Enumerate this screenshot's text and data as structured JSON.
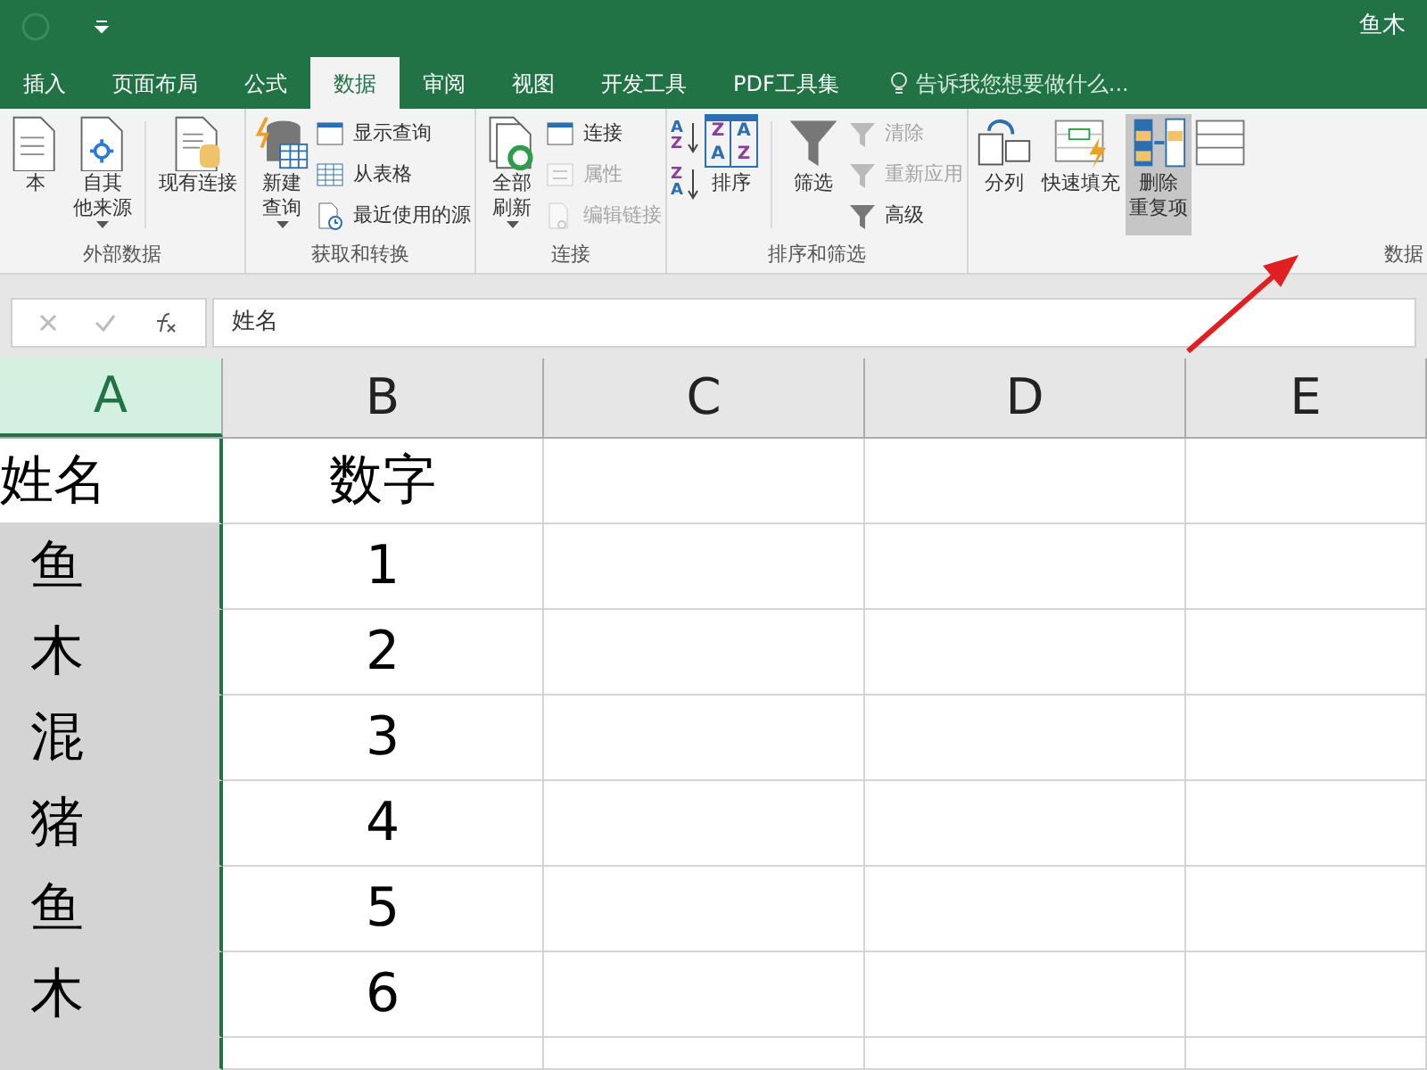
{
  "window": {
    "title": "鱼木"
  },
  "tabs": [
    {
      "label": "插入",
      "selected": false
    },
    {
      "label": "页面布局",
      "selected": false
    },
    {
      "label": "公式",
      "selected": false
    },
    {
      "label": "数据",
      "selected": true
    },
    {
      "label": "审阅",
      "selected": false
    },
    {
      "label": "视图",
      "selected": false
    },
    {
      "label": "开发工具",
      "selected": false
    },
    {
      "label": "PDF工具集",
      "selected": false
    }
  ],
  "tell_me": {
    "placeholder": "告诉我您想要做什么..."
  },
  "ribbon_groups": [
    {
      "label": "外部数据",
      "items": [
        {
          "kind": "large",
          "label": "本"
        },
        {
          "kind": "large",
          "label": "自其他来源",
          "dropdown": true
        },
        {
          "kind": "sep"
        },
        {
          "kind": "large",
          "label": "现有连接"
        }
      ]
    },
    {
      "label": "获取和转换",
      "items": [
        {
          "kind": "large",
          "label": "新建查询",
          "dropdown": true
        },
        {
          "kind": "stack",
          "rows": [
            {
              "label": "显示查询",
              "disabled": false
            },
            {
              "label": "从表格",
              "disabled": false
            },
            {
              "label": "最近使用的源",
              "disabled": false
            }
          ]
        }
      ]
    },
    {
      "label": "连接",
      "items": [
        {
          "kind": "large",
          "label": "全部刷新",
          "dropdown": true
        },
        {
          "kind": "stack",
          "rows": [
            {
              "label": "连接",
              "disabled": false
            },
            {
              "label": "属性",
              "disabled": true
            },
            {
              "label": "编辑链接",
              "disabled": true
            }
          ]
        }
      ]
    },
    {
      "label": "排序和筛选",
      "items": [
        {
          "kind": "sortpair",
          "buttons": [
            [
              "A",
              "Z"
            ],
            [
              "Z",
              "A"
            ]
          ]
        },
        {
          "kind": "sortbig",
          "label": "排序",
          "letters": [
            "Z",
            "A",
            "A",
            "Z"
          ]
        },
        {
          "kind": "sep"
        },
        {
          "kind": "large",
          "label": "筛选"
        },
        {
          "kind": "stack",
          "rows": [
            {
              "label": "清除",
              "disabled": true
            },
            {
              "label": "重新应用",
              "disabled": true
            },
            {
              "label": "高级",
              "disabled": false
            }
          ]
        }
      ]
    },
    {
      "label": "数据",
      "items": [
        {
          "kind": "large",
          "label": "分列"
        },
        {
          "kind": "large",
          "label": "快速填充"
        },
        {
          "kind": "large",
          "label": "删除重复项",
          "selected": true
        },
        {
          "kind": "cut"
        }
      ]
    }
  ],
  "formula_bar": {
    "value": "姓名"
  },
  "columns": [
    {
      "label": "A",
      "selected": true
    },
    {
      "label": "B",
      "selected": false
    },
    {
      "label": "C",
      "selected": false
    },
    {
      "label": "D",
      "selected": false
    },
    {
      "label": "E",
      "selected": false
    }
  ],
  "rows": [
    [
      "姓名",
      "数字"
    ],
    [
      "鱼",
      "1"
    ],
    [
      "木",
      "2"
    ],
    [
      "混",
      "3"
    ],
    [
      "猪",
      "4"
    ],
    [
      "鱼",
      "5"
    ],
    [
      "木",
      "6"
    ]
  ]
}
